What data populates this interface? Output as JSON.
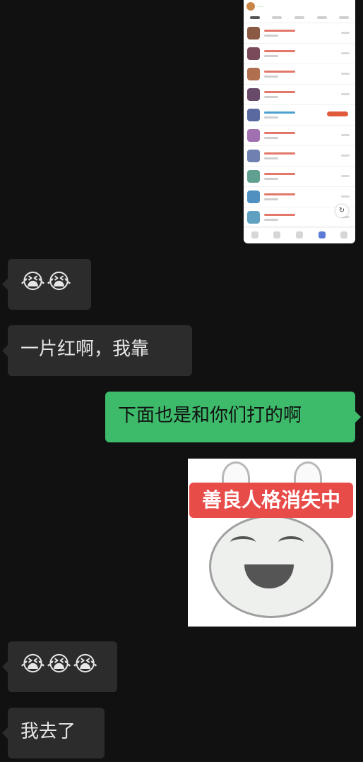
{
  "screenshot_preview": {
    "description_hidden": "",
    "rows": 10
  },
  "messages": [
    {
      "side": "left",
      "type": "emoji",
      "text": "😭😭"
    },
    {
      "side": "left",
      "type": "text",
      "text": "一片红啊，我靠"
    },
    {
      "side": "right",
      "type": "text",
      "text": "下面也是和你们打的啊"
    },
    {
      "side": "right",
      "type": "sticker",
      "text": "善良人格消失中"
    },
    {
      "side": "left",
      "type": "emoji",
      "text": "😭😭😭"
    },
    {
      "side": "left",
      "type": "text",
      "text": "我去了"
    }
  ],
  "colors": {
    "background": "#111111",
    "left_bubble": "#2c2c2c",
    "right_bubble": "#3dbb6b",
    "sticker_banner": "#e74c49"
  }
}
